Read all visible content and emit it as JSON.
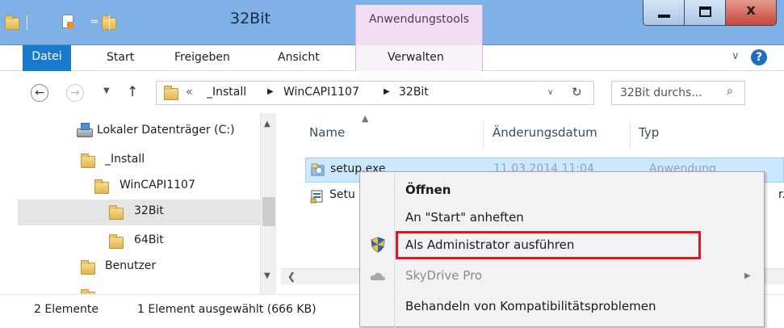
{
  "window": {
    "title": "32Bit",
    "context_tab_header": "Anwendungstools",
    "close_glyph": "x"
  },
  "ribbon": {
    "tabs": [
      "Datei",
      "Start",
      "Freigeben",
      "Ansicht",
      "Verwalten"
    ],
    "help": "?",
    "chevron": "∨"
  },
  "address": {
    "overflow": "«",
    "crumbs": [
      "_Install",
      "WinCAPI1107",
      "32Bit"
    ],
    "separator": "▶",
    "search_placeholder": "32Bit durchs..."
  },
  "navigation": {
    "items": [
      {
        "label": "Lokaler Datenträger (C:)",
        "icon": "drive-icon"
      },
      {
        "label": "_Install",
        "icon": "folder-icon"
      },
      {
        "label": "WinCAPI1107",
        "icon": "folder-icon"
      },
      {
        "label": "32Bit",
        "icon": "folder-icon",
        "selected": true
      },
      {
        "label": "64Bit",
        "icon": "folder-icon"
      },
      {
        "label": "Benutzer",
        "icon": "folder-icon"
      }
    ]
  },
  "file_list": {
    "columns": [
      "Name",
      "Änderungsdatum",
      "Typ"
    ],
    "rows": [
      {
        "name": "setup.exe",
        "date": "11.03.2014 11:04",
        "type": "Anwendung",
        "selected": true
      },
      {
        "name": "Setu",
        "type_suffix": "r."
      }
    ]
  },
  "status": {
    "count": "2 Elemente",
    "selection": "1 Element ausgewählt (666 KB)"
  },
  "context_menu": {
    "items": [
      {
        "label": "Öffnen",
        "bold": true
      },
      {
        "label": "An \"Start\" anheften"
      },
      {
        "label": "Als Administrator ausführen",
        "icon": "shield-icon",
        "highlighted": true
      },
      {
        "label": "SkyDrive Pro",
        "icon": "cloud-icon",
        "disabled": true,
        "submenu": true
      },
      {
        "label": "Behandeln von Kompatibilitätsproblemen"
      }
    ]
  },
  "colors": {
    "titlebar": "#7fb0e6",
    "file_tab": "#1979ca",
    "context_tab": "#f1def0",
    "selection": "#cce8ff",
    "highlight_box": "#e2141f"
  }
}
